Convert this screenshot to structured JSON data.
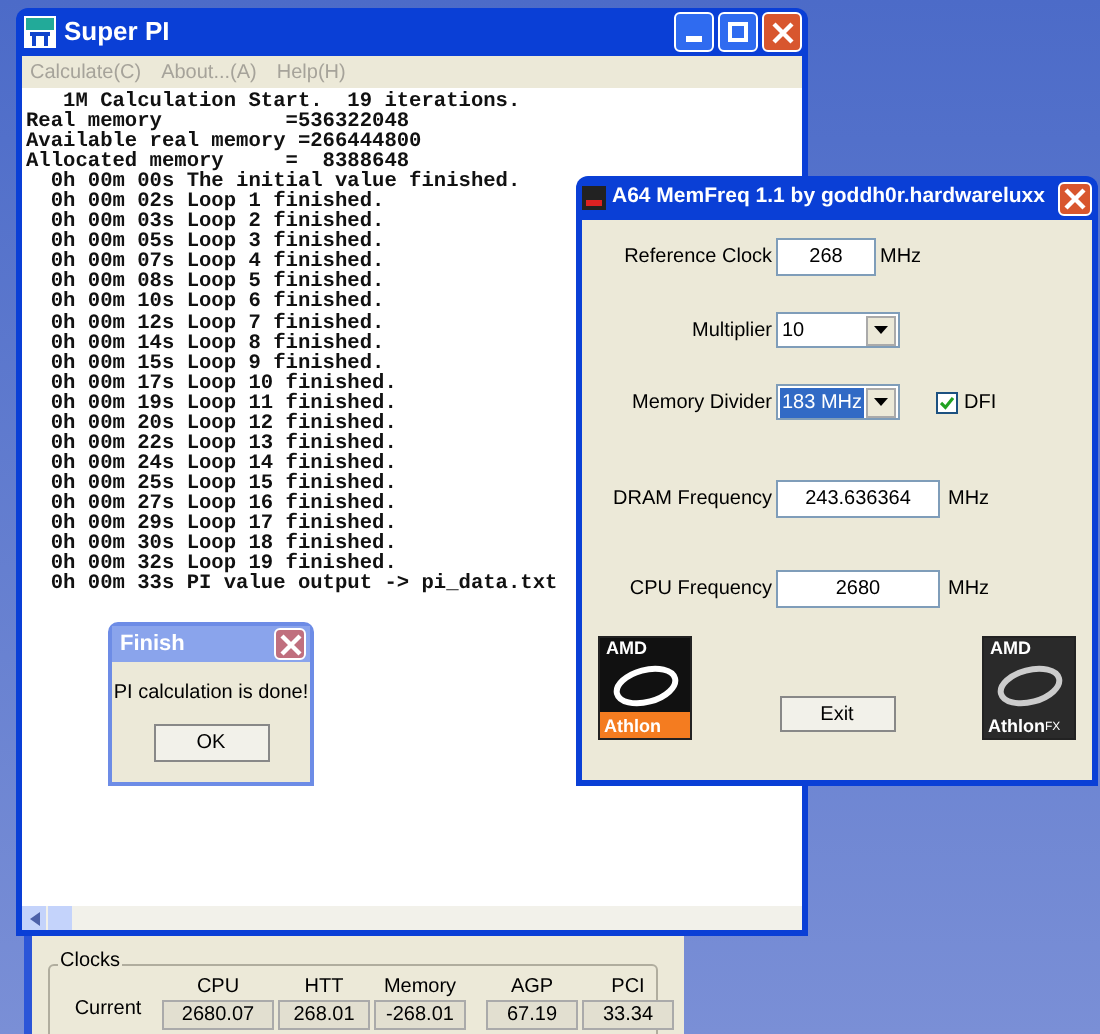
{
  "superpi": {
    "title": "Super PI",
    "menu": [
      "Calculate(C)",
      "About...(A)",
      "Help(H)"
    ],
    "log": [
      "   1M Calculation Start.  19 iterations.",
      "Real memory          =536322048",
      "Available real memory =266444800",
      "Allocated memory     =  8388648",
      "  0h 00m 00s The initial value finished.",
      "  0h 00m 02s Loop 1 finished.",
      "  0h 00m 03s Loop 2 finished.",
      "  0h 00m 05s Loop 3 finished.",
      "  0h 00m 07s Loop 4 finished.",
      "  0h 00m 08s Loop 5 finished.",
      "  0h 00m 10s Loop 6 finished.",
      "  0h 00m 12s Loop 7 finished.",
      "  0h 00m 14s Loop 8 finished.",
      "  0h 00m 15s Loop 9 finished.",
      "  0h 00m 17s Loop 10 finished.",
      "  0h 00m 19s Loop 11 finished.",
      "  0h 00m 20s Loop 12 finished.",
      "  0h 00m 22s Loop 13 finished.",
      "  0h 00m 24s Loop 14 finished.",
      "  0h 00m 25s Loop 15 finished.",
      "  0h 00m 27s Loop 16 finished.",
      "  0h 00m 29s Loop 17 finished.",
      "  0h 00m 30s Loop 18 finished.",
      "  0h 00m 32s Loop 19 finished.",
      "  0h 00m 33s PI value output -> pi_data.txt"
    ]
  },
  "finish_dialog": {
    "title": "Finish",
    "message": "PI calculation is done!",
    "button": "OK"
  },
  "memfreq": {
    "title": "A64 MemFreq 1.1 by goddh0r.hardwareluxx",
    "reference_clock": {
      "label": "Reference Clock",
      "value": "268",
      "unit": "MHz"
    },
    "multiplier": {
      "label": "Multiplier",
      "value": "10"
    },
    "memory_divider": {
      "label": "Memory Divider",
      "value": "183 MHz"
    },
    "dfi": {
      "label": "DFI",
      "checked": true
    },
    "dram_frequency": {
      "label": "DRAM Frequency",
      "value": "243.636364",
      "unit": "MHz"
    },
    "cpu_frequency": {
      "label": "CPU Frequency",
      "value": "2680",
      "unit": "MHz"
    },
    "logos": [
      {
        "top": "AMD",
        "bottom": "Athlon"
      },
      {
        "top": "AMD",
        "bottom": "Athlon",
        "suffix": "FX"
      }
    ],
    "exit_button": "Exit"
  },
  "clocks": {
    "group": "Clocks",
    "row_label": "Current",
    "columns": [
      {
        "name": "CPU",
        "value": "2680.07"
      },
      {
        "name": "HTT",
        "value": "268.01"
      },
      {
        "name": "Memory",
        "value": "-268.01"
      },
      {
        "name": "AGP",
        "value": "67.19"
      },
      {
        "name": "PCI",
        "value": "33.34"
      }
    ]
  }
}
